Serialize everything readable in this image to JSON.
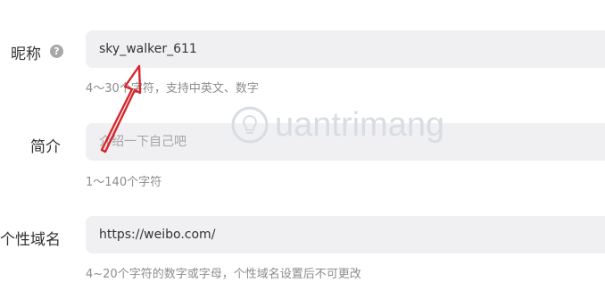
{
  "form": {
    "nickname": {
      "label": "昵称",
      "help_icon": "question-mark-icon",
      "value": "sky_walker_611",
      "hint": "4～30个字符，支持中英文、数字"
    },
    "bio": {
      "label": "简介",
      "placeholder": "介绍一下自己吧",
      "hint": "1～140个字符"
    },
    "domain": {
      "label": "个性域名",
      "value": "https://weibo.com/",
      "hint": "4~20个字符的数字或字母，个性域名设置后不可更改"
    }
  },
  "watermark": {
    "text": "uantrimang",
    "icon": "lightbulb-icon"
  },
  "colors": {
    "field_bg": "#f0f0f3",
    "hint": "#8c8c8c",
    "arrow": "#d6262c"
  }
}
